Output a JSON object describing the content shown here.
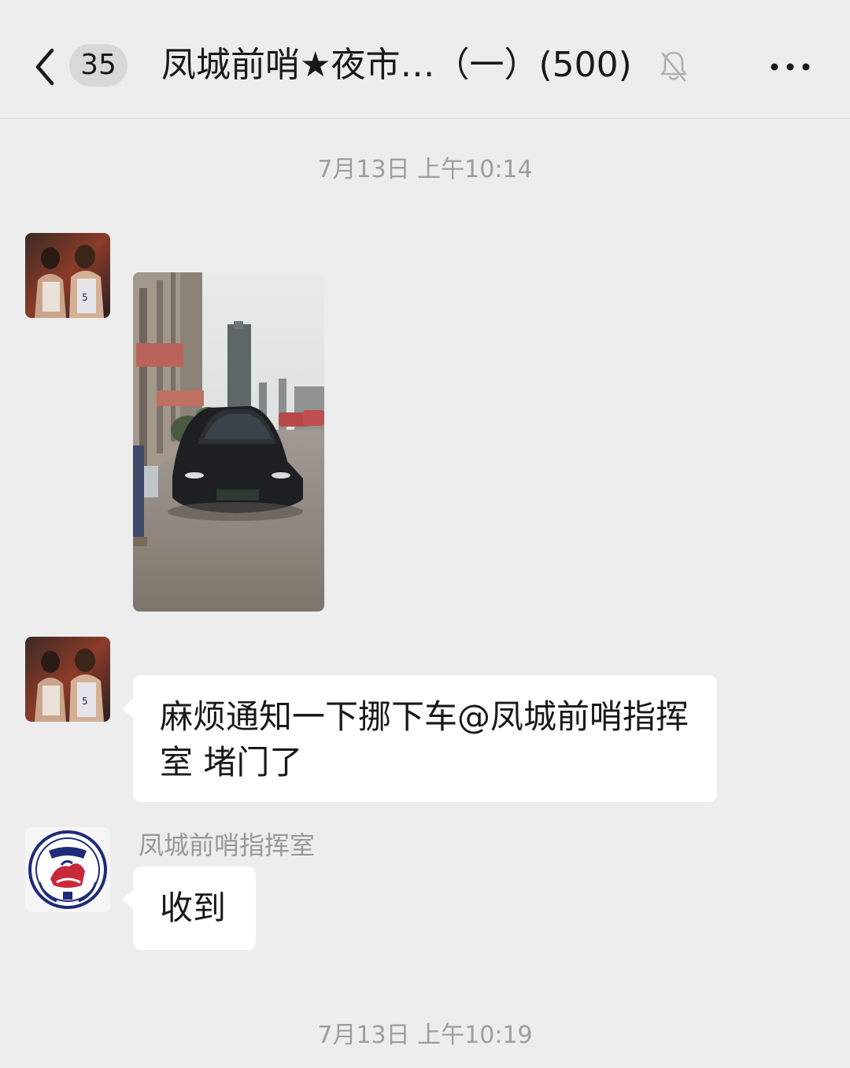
{
  "header": {
    "unread_count": "35",
    "title": "凤城前哨★夜市…（一）(500)",
    "back_icon": "chevron-left-icon",
    "mute_icon": "bell-off-icon",
    "more_icon": "more-dots-icon"
  },
  "messages": {
    "timestamp_1": "7月13日 上午10:14",
    "text_1": "麻烦通知一下挪下车@凤城前哨指挥室  堵门了",
    "sender_3": "凤城前哨指挥室",
    "text_3": "收到",
    "timestamp_2": "7月13日 上午10:19"
  },
  "colors": {
    "background": "#ededed",
    "bubble": "#ffffff",
    "text": "#191919",
    "muted_text": "#9e9e9e"
  }
}
